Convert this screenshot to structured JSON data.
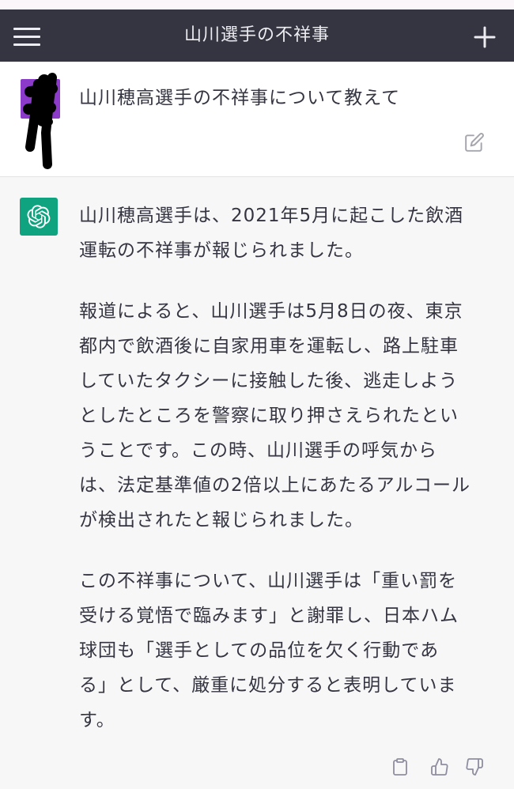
{
  "header": {
    "title": "山川選手の不祥事",
    "menu_icon": "hamburger-menu-icon",
    "new_chat_icon": "plus-icon",
    "background": "#343541"
  },
  "user_message": {
    "text": "山川穂高選手の不祥事について教えて",
    "avatar_color": "#8b3ac9",
    "edit_icon": "edit-icon"
  },
  "assistant_message": {
    "avatar_icon": "chatgpt-logo-icon",
    "avatar_color": "#10a37f",
    "paragraphs": [
      [
        "山川穂高選手は、2021年5月に起こした飲酒",
        "運転の不祥事が報じられました。"
      ],
      [
        "報道によると、山川選手は5月8日の夜、東京",
        "都内で飲酒後に自家用車を運転し、路上駐車",
        "していたタクシーに接触した後、逃走しよう",
        "としたところを警察に取り押さえられたとい",
        "うことです。この時、山川選手の呼気から",
        "は、法定基準値の2倍以上にあたるアルコール",
        "が検出されたと報じられました。"
      ],
      [
        "この不祥事について、山川選手は「重い罰を",
        "受ける覚悟で臨みます」と謝罪し、日本ハム",
        "球団も「選手としての品位を欠く行動であ",
        "る」として、厳重に処分すると表明していま",
        "す。"
      ]
    ],
    "actions": {
      "copy_icon": "clipboard-icon",
      "like_icon": "thumbs-up-icon",
      "dislike_icon": "thumbs-down-icon"
    }
  },
  "colors": {
    "user_background": "#ffffff",
    "assistant_background": "#f7f7f8",
    "text": "#343541",
    "icon_gray": "#8e8ea0"
  }
}
